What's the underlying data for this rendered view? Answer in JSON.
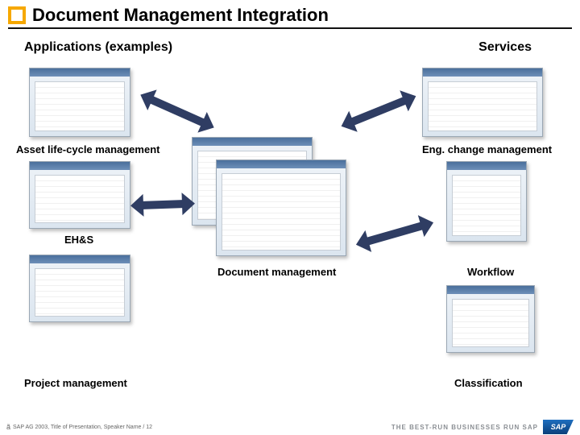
{
  "title": "Document Management Integration",
  "headings": {
    "applications": "Applications (examples)",
    "services": "Services"
  },
  "labels": {
    "asset": "Asset life-cycle management",
    "ehs": "EH&S",
    "project": "Project management",
    "docmgmt": "Document management",
    "engchange": "Eng. change management",
    "workflow": "Workflow",
    "classification": "Classification"
  },
  "footer": {
    "copyright": "SAP AG 2003, Title of Presentation, Speaker Name / 12",
    "tagline": "THE BEST-RUN BUSINESSES RUN SAP",
    "logo_text": "SAP"
  }
}
